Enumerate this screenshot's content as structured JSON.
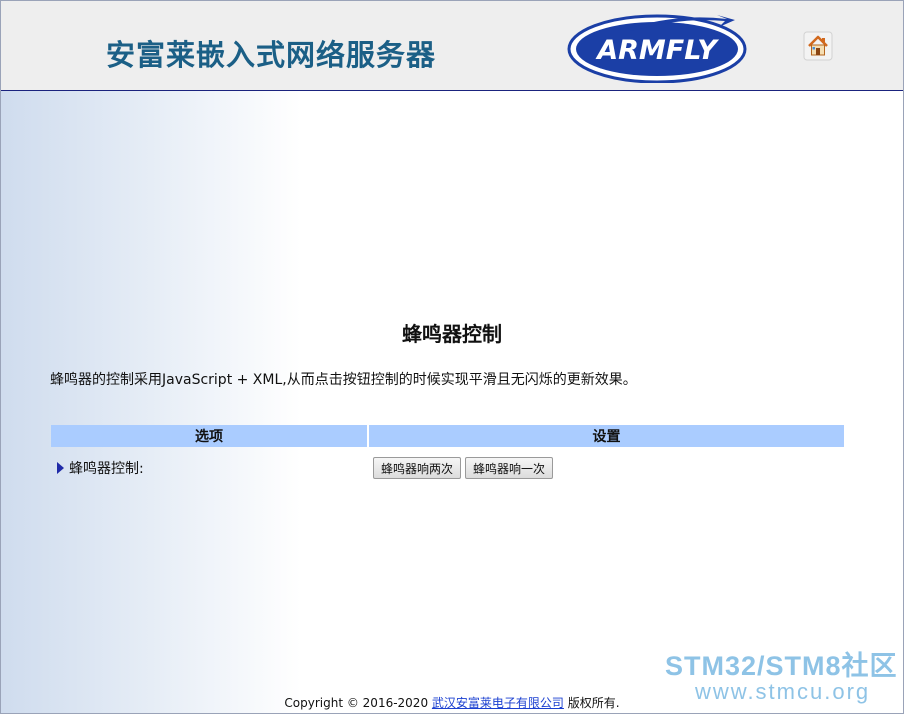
{
  "header": {
    "site_title": "安富莱嵌入式网络服务器",
    "logo_text": "ARMFLY",
    "home_icon": "home-icon"
  },
  "main": {
    "heading": "蜂鸣器控制",
    "description": "蜂鸣器的控制采用JavaScript + XML,从而点击按钮控制的时候实现平滑且无闪烁的更新效果。",
    "table": {
      "headers": [
        "选项",
        "设置"
      ],
      "rows": [
        {
          "label": "蜂鸣器控制:",
          "buttons": [
            "蜂鸣器响两次",
            "蜂鸣器响一次"
          ]
        }
      ]
    }
  },
  "footer": {
    "copyright_prefix": "Copyright © 2016-2020",
    "company_link": "武汉安富莱电子有限公司",
    "rights": "版权所有."
  },
  "watermark": {
    "line1": "STM32/STM8社区",
    "line2": "www.stmcu.org"
  },
  "colors": {
    "title": "#1b5f86",
    "logo": "#1b3fa6",
    "table_header": "#aaccff",
    "watermark": "#8ec3e6"
  }
}
